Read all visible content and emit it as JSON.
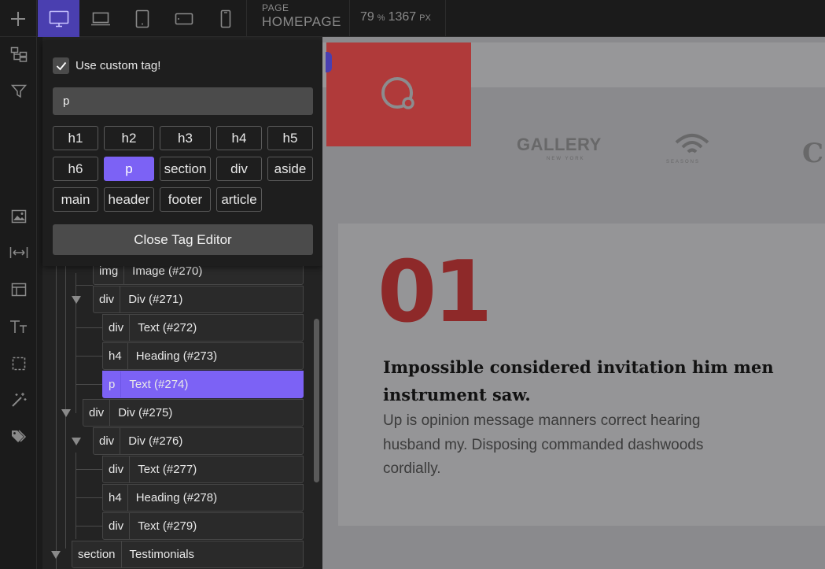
{
  "topbar": {
    "page_label": "PAGE",
    "page_name": "HOMEPAGE",
    "zoom": "79",
    "zoom_unit": "%",
    "width": "1367",
    "width_unit": "PX",
    "devices": [
      "desktop-icon",
      "laptop-icon",
      "tablet-icon",
      "tablet-landscape-icon",
      "phone-icon"
    ],
    "active_device": "desktop-icon"
  },
  "rail": {
    "icons": [
      "navigator-icon",
      "filter-icon",
      "image-icon",
      "spacing-icon",
      "layout-icon",
      "typography-icon",
      "border-icon",
      "magic-wand-icon",
      "tags-icon"
    ]
  },
  "tag_editor": {
    "checkbox_label": "Use custom tag!",
    "checkbox_checked": true,
    "input_value": "p",
    "tags": [
      "h1",
      "h2",
      "h3",
      "h4",
      "h5",
      "h6",
      "p",
      "section",
      "div",
      "aside",
      "main",
      "header",
      "footer",
      "article"
    ],
    "selected_tag": "p",
    "close_label": "Close Tag Editor"
  },
  "tree": {
    "rows": [
      {
        "tag": "img",
        "name": "Image (#270)"
      },
      {
        "tag": "div",
        "name": "Div (#271)"
      },
      {
        "tag": "div",
        "name": "Text (#272)"
      },
      {
        "tag": "h4",
        "name": "Heading (#273)"
      },
      {
        "tag": "p",
        "name": "Text (#274)",
        "selected": true
      },
      {
        "tag": "div",
        "name": "Div (#275)"
      },
      {
        "tag": "div",
        "name": "Div (#276)"
      },
      {
        "tag": "div",
        "name": "Text (#277)"
      },
      {
        "tag": "h4",
        "name": "Heading (#278)"
      },
      {
        "tag": "div",
        "name": "Text (#279)"
      },
      {
        "tag": "section",
        "name": "Testimonials"
      }
    ]
  },
  "canvas": {
    "brand_gallery": "GALLERY",
    "brand_gallery_sub": "NEW YORK",
    "brand_seasons": "SEASONS",
    "brand_edge": "C",
    "card_number": "01",
    "card_title": "Impossible considered invitation him men instrument saw.",
    "card_body": "Up is opinion message manners correct hearing husband my. Disposing commanded dashwoods cordially."
  },
  "colors": {
    "accent": "#7c62f5",
    "active_device_bg": "#4a3fb0",
    "logo_red": "#b03a3a",
    "number_red": "#8e2929"
  }
}
